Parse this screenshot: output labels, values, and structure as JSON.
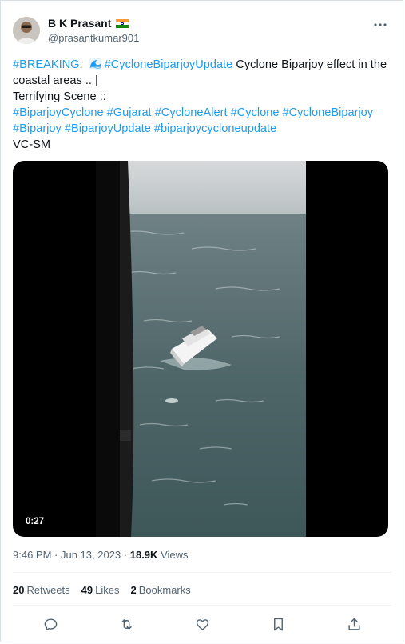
{
  "author": {
    "name": "B K Prasant",
    "handle": "@prasantkumar901",
    "flag_icon": "india-flag-icon"
  },
  "tweet": {
    "segments": [
      {
        "text": "#BREAKING",
        "kind": "tag"
      },
      {
        "text": ": ",
        "kind": "plain"
      },
      {
        "text": "",
        "kind": "wave-emoji"
      },
      {
        "text": "#CycloneBiparjoyUpdate",
        "kind": "tag"
      },
      {
        "text": "  Cyclone Biparjoy effect in the coastal areas .. |",
        "kind": "plain"
      },
      {
        "text": "\n",
        "kind": "break"
      },
      {
        "text": "Terrifying  Scene ::",
        "kind": "plain"
      },
      {
        "text": "\n",
        "kind": "break"
      },
      {
        "text": "#BiparjoyCyclone",
        "kind": "tag"
      },
      {
        "text": " ",
        "kind": "plain"
      },
      {
        "text": "#Gujarat",
        "kind": "tag"
      },
      {
        "text": " ",
        "kind": "plain"
      },
      {
        "text": "#CycloneAlert",
        "kind": "tag"
      },
      {
        "text": " ",
        "kind": "plain"
      },
      {
        "text": "#Cyclone",
        "kind": "tag"
      },
      {
        "text": " ",
        "kind": "plain"
      },
      {
        "text": "#CycloneBiparjoy",
        "kind": "tag"
      },
      {
        "text": " ",
        "kind": "plain"
      },
      {
        "text": "#Biparjoy",
        "kind": "tag"
      },
      {
        "text": " ",
        "kind": "plain"
      },
      {
        "text": "#BiparjoyUpdate",
        "kind": "tag"
      },
      {
        "text": " ",
        "kind": "plain"
      },
      {
        "text": "#biparjoycycloneupdate",
        "kind": "tag"
      },
      {
        "text": "\n",
        "kind": "break"
      },
      {
        "text": "VC-SM",
        "kind": "plain"
      }
    ]
  },
  "media": {
    "duration": "0:27"
  },
  "meta": {
    "time": "9:46 PM",
    "sep1": " · ",
    "date": "Jun 13, 2023",
    "sep2": " · ",
    "views_count": "18.9K",
    "views_label": " Views"
  },
  "stats": {
    "retweets_count": "20",
    "retweets_label": "Retweets",
    "likes_count": "49",
    "likes_label": "Likes",
    "bookmarks_count": "2",
    "bookmarks_label": "Bookmarks"
  },
  "actions": [
    "reply-icon",
    "retweet-icon",
    "like-icon",
    "bookmark-icon",
    "share-icon"
  ],
  "colors": {
    "link": "#1d9bf0",
    "secondary": "#536471",
    "text": "#0f1419"
  }
}
